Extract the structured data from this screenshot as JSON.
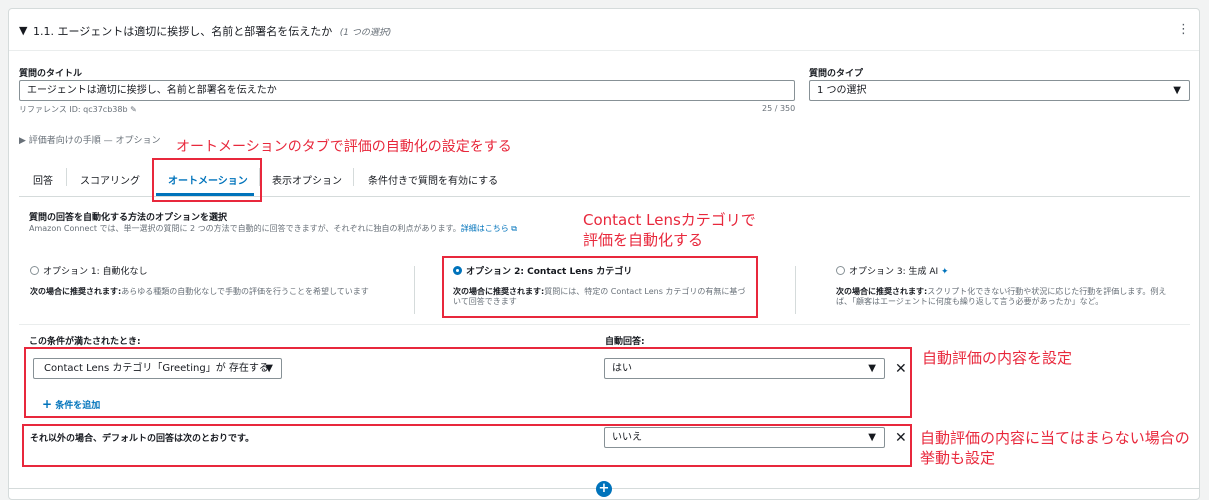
{
  "header": {
    "title": "1.1. エージェントは適切に挨拶し、名前と部署名を伝えたか",
    "subtitle": "(1 つの選択)"
  },
  "form": {
    "title_label": "質問のタイトル",
    "title_value": "エージェントは適切に挨拶し、名前と部署名を伝えたか",
    "reference_id": "リファレンス ID: qc37cb38b",
    "char_count": "25 / 350",
    "type_label": "質問のタイプ",
    "type_value": "1 つの選択",
    "evaluator_instructions": "評価者向けの手順 — オプション"
  },
  "tabs": [
    {
      "label": "回答"
    },
    {
      "label": "スコアリング"
    },
    {
      "label": "オートメーション"
    },
    {
      "label": "表示オプション"
    },
    {
      "label": "条件付きで質問を有効にする"
    }
  ],
  "automation": {
    "heading": "質問の回答を自動化する方法のオプションを選択",
    "description": "Amazon Connect では、単一選択の質問に 2 つの方法で自動的に回答できますが、それぞれに独自の利点があります。",
    "learn_more": "詳細はこちら",
    "options": [
      {
        "title": "オプション 1: 自動化なし",
        "rec_label": "次の場合に推奨されます:",
        "rec_text": "あらゆる種類の自動化なしで手動の評価を行うことを希望しています",
        "selected": false
      },
      {
        "title": "オプション 2: Contact Lens カテゴリ",
        "rec_label": "次の場合に推奨されます:",
        "rec_text": "質問には、特定の Contact Lens カテゴリの有無に基づいて回答できます",
        "selected": true
      },
      {
        "title": "オプション 3: 生成 AI",
        "rec_label": "次の場合に推奨されます:",
        "rec_text": "スクリプト化できない行動や状況に応じた行動を評価します。例えば、「顧客はエージェントに何度も繰り返して言う必要があったか」など。",
        "selected": false
      }
    ],
    "condition_label": "この条件が満たされたとき:",
    "answer_label": "自動回答:",
    "condition_value": "Contact Lens カテゴリ「Greeting」が 存在する",
    "answer_value": "はい",
    "add_condition": "条件を追加",
    "default_label": "それ以外の場合、デフォルトの回答は次のとおりです。",
    "default_value": "いいえ"
  },
  "annotations": {
    "a1": "オートメーションのタブで評価の自動化の設定をする",
    "a2_line1": "Contact Lensカテゴリで",
    "a2_line2": "評価を自動化する",
    "a3": "自動評価の内容を設定",
    "a4_line1": "自動評価の内容に当てはまらない場合の",
    "a4_line2": "挙動も設定"
  },
  "colors": {
    "accent": "#0073bb",
    "annotation_red": "#e8283c"
  }
}
